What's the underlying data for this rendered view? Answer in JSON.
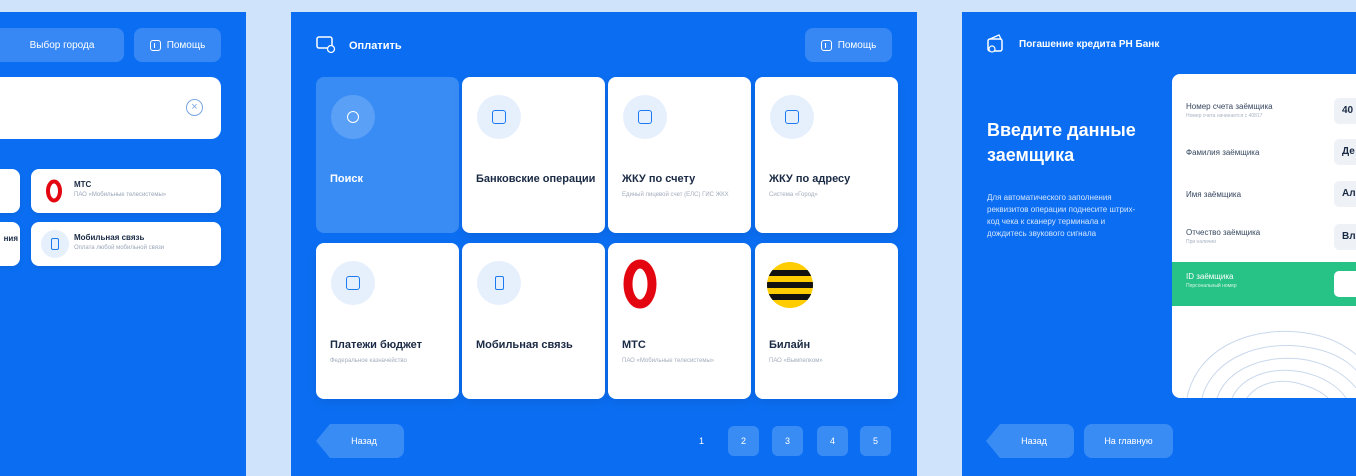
{
  "screen1": {
    "city_button": "Выбор города",
    "help_button": "Помощь",
    "search_clear": "×",
    "cards": [
      {
        "title": "МТС",
        "subtitle": "ПАО «Мобильные телесистемы»"
      },
      {
        "title": "Мобильная связь",
        "subtitle": "Оплата любой мобильной связи"
      }
    ],
    "partial_text": "ния"
  },
  "screen2": {
    "title": "Оплатить",
    "help_button": "Помощь",
    "tiles": [
      {
        "title": "Поиск",
        "subtitle": ""
      },
      {
        "title": "Банковские операции",
        "subtitle": ""
      },
      {
        "title": "ЖКУ по счету",
        "subtitle": "Единый лицевой счет (ЕЛС) ГИС ЖКХ"
      },
      {
        "title": "ЖКУ по адресу",
        "subtitle": "Система «Город»"
      },
      {
        "title": "Платежи бюджет",
        "subtitle": "Федеральное казначейство"
      },
      {
        "title": "Мобильная связь",
        "subtitle": ""
      },
      {
        "title": "МТС",
        "subtitle": "ПАО «Мобильные телесистемы»"
      },
      {
        "title": "Билайн",
        "subtitle": "ПАО «Вымпелком»"
      }
    ],
    "back_button": "Назад",
    "pages": [
      "1",
      "2",
      "3",
      "4",
      "5"
    ],
    "current_page": "1"
  },
  "screen3": {
    "title": "Погашение кредита РН Банк",
    "heading": "Введите данные заемщика",
    "instructions": "Для автоматического заполнения реквизитов операции поднесите штрих-код чека к сканеру терминала и дождитесь звукового сигнала",
    "fields": [
      {
        "label": "Номер счета заёмщика",
        "hint": "Номер счета начинается с 40817",
        "value": "40"
      },
      {
        "label": "Фамилия заёмщика",
        "hint": "",
        "value": "Де"
      },
      {
        "label": "Имя заёмщика",
        "hint": "",
        "value": "Ал"
      },
      {
        "label": "Отчество заёмщика",
        "hint": "При наличии",
        "value": "Вл"
      },
      {
        "label": "ID заёмщика",
        "hint": "Персональный номер",
        "value": ""
      }
    ],
    "back_button": "Назад",
    "home_button": "На главную"
  },
  "colors": {
    "background": "#cfe3fb",
    "panel": "#0b6ef2",
    "accent_green": "#27c286",
    "mts_red": "#e30611",
    "beeline_yellow": "#ffcc00"
  }
}
